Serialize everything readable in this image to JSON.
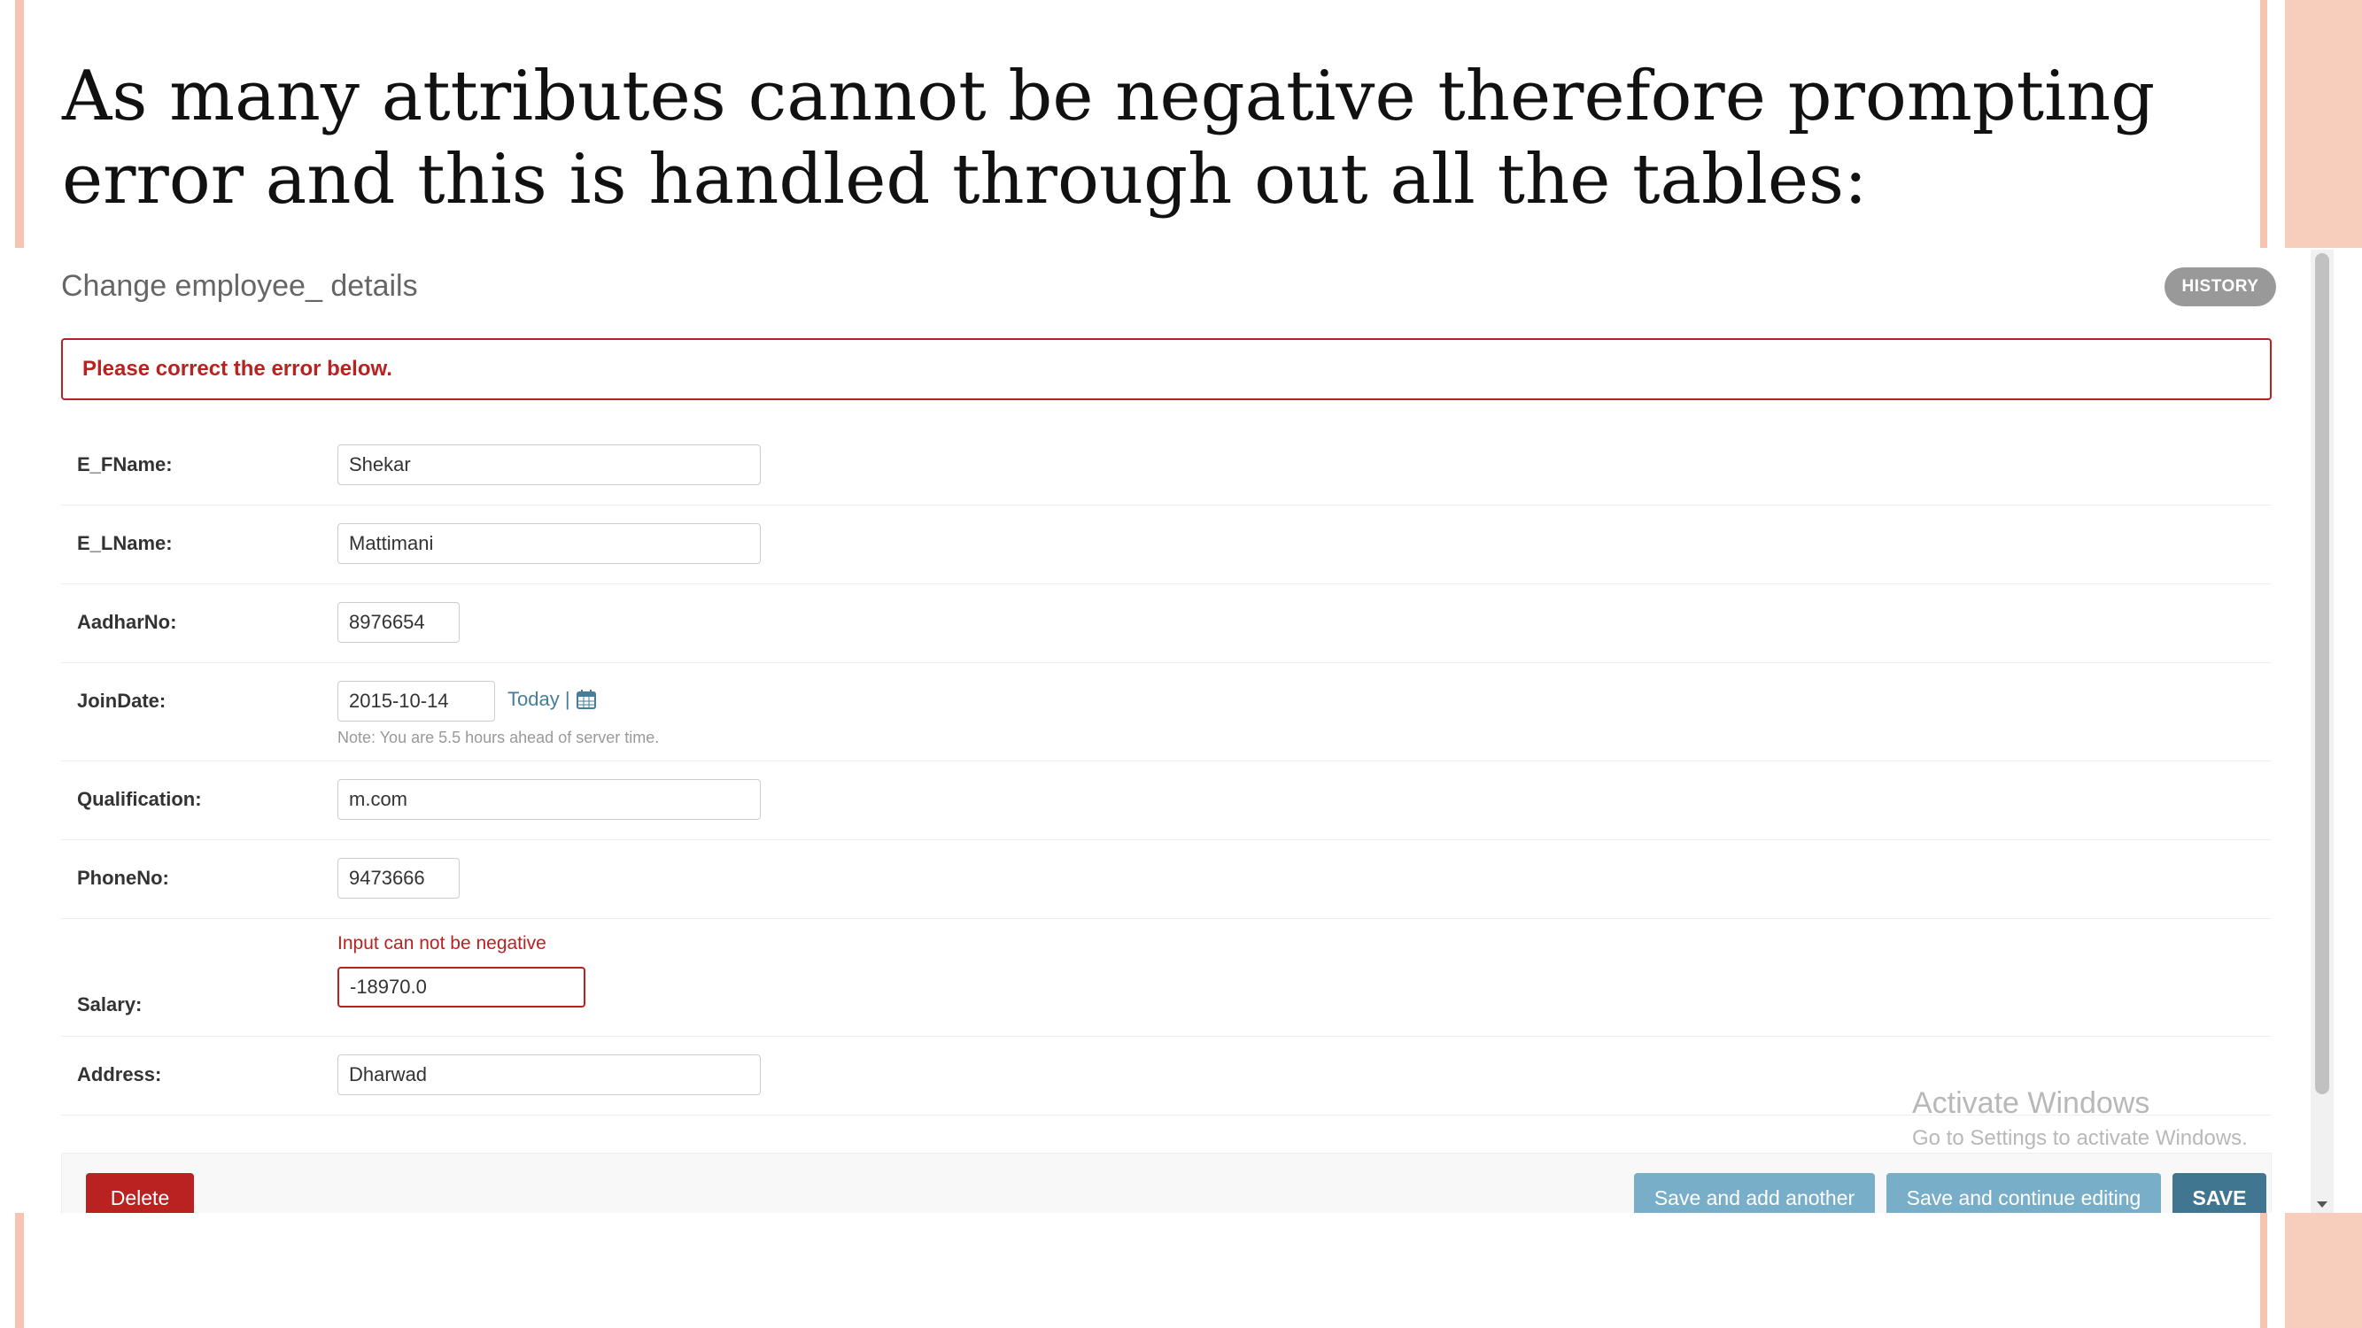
{
  "slide": {
    "title": "As many attributes cannot be negative therefore prompting error and this is handled through out all the tables:"
  },
  "admin": {
    "heading": "Change employee_ details",
    "history_label": "HISTORY",
    "error_note": "Please correct the error below."
  },
  "fields": {
    "e_fname": {
      "label": "E_FName:",
      "value": "Shekar"
    },
    "e_lname": {
      "label": "E_LName:",
      "value": "Mattimani"
    },
    "aadhar": {
      "label": "AadharNo:",
      "value": "8976654"
    },
    "joindate": {
      "label": "JoinDate:",
      "value": "2015-10-14",
      "today_label": "Today |",
      "note": "Note: You are 5.5 hours ahead of server time."
    },
    "qualification": {
      "label": "Qualification:",
      "value": "m.com"
    },
    "phone": {
      "label": "PhoneNo:",
      "value": "9473666"
    },
    "salary": {
      "label": "Salary:",
      "value": "-18970.0",
      "error": "Input can not be negative"
    },
    "address": {
      "label": "Address:",
      "value": "Dharwad"
    }
  },
  "actions": {
    "delete_label": "Delete",
    "save_add_label": "Save and add another",
    "save_continue_label": "Save and continue editing",
    "save_label": "SAVE"
  },
  "watermark": {
    "title": "Activate Windows",
    "subtitle": "Go to Settings to activate Windows."
  },
  "colors": {
    "error": "#ba2121",
    "primary_button": "#417690",
    "secondary_button": "#79aec8",
    "link": "#447e9b",
    "accent_stripe": "#f6c4b0"
  },
  "icons": [
    "calendar-icon"
  ]
}
